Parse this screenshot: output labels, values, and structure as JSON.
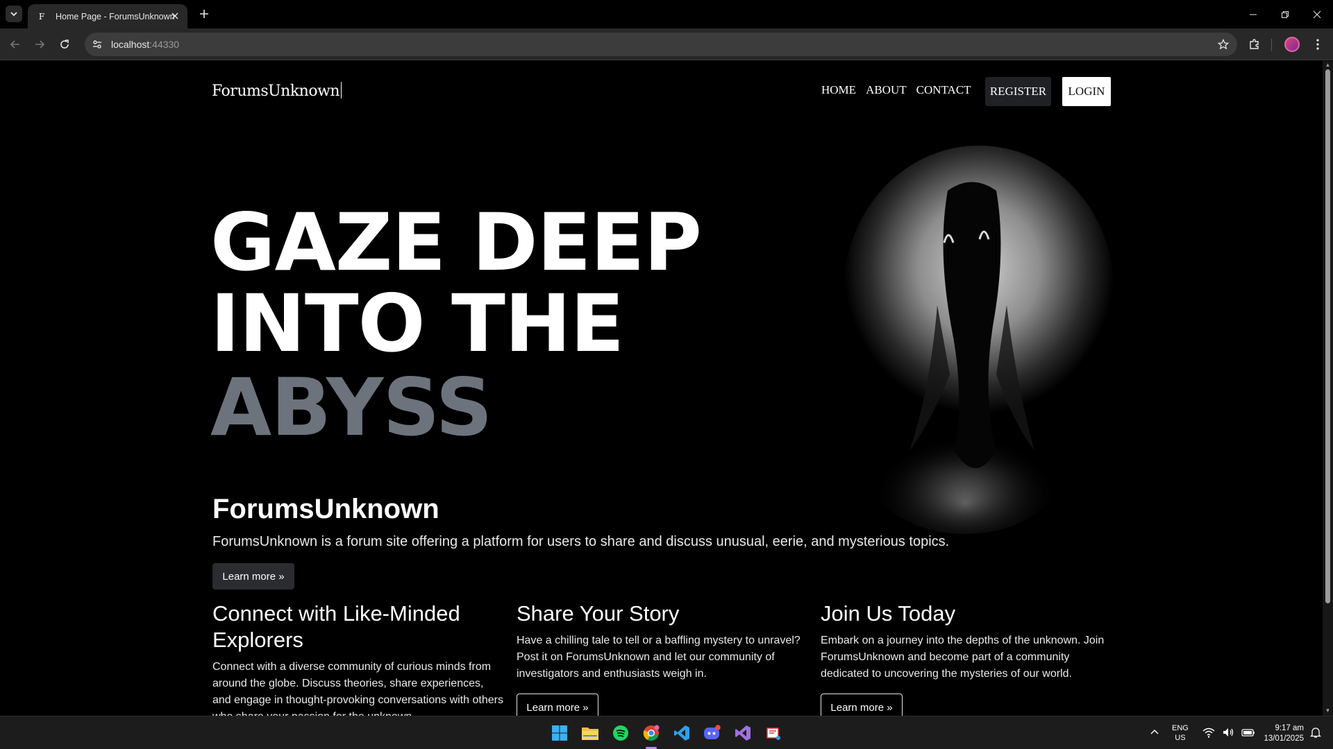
{
  "browser": {
    "tab_title": "Home Page - ForumsUnknown",
    "tab_favicon_letter": "F",
    "url_host": "localhost",
    "url_port": ":44330"
  },
  "site": {
    "brand": "ForumsUnknown",
    "nav": [
      "HOME",
      "ABOUT",
      "CONTACT"
    ],
    "register_label": "REGISTER",
    "login_label": "LOGIN"
  },
  "hero": {
    "line1": "GAZE DEEP",
    "line2": "INTO THE",
    "line3": "ABYSS"
  },
  "intro": {
    "title": "ForumsUnknown",
    "lead": "ForumsUnknown is a forum site offering a platform for users to share and discuss unusual, eerie, and mysterious topics.",
    "button": "Learn more »"
  },
  "columns": [
    {
      "title": "Connect with Like-Minded Explorers",
      "text": "Connect with a diverse community of curious minds from around the globe. Discuss theories, share experiences, and engage in thought-provoking conversations with others who share your passion for the unknown."
    },
    {
      "title": "Share Your Story",
      "text": "Have a chilling tale to tell or a baffling mystery to unravel? Post it on ForumsUnknown and let our community of investigators and enthusiasts weigh in.",
      "button": "Learn more »"
    },
    {
      "title": "Join Us Today",
      "text": "Embark on a journey into the depths of the unknown. Join ForumsUnknown and become part of a community dedicated to uncovering the mysteries of our world.",
      "button": "Learn more »"
    }
  ],
  "taskbar": {
    "lang_line1": "ENG",
    "lang_line2": "US",
    "time": "9:17 am",
    "date": "13/01/2025",
    "apps": [
      "windows-start-icon",
      "file-explorer-icon",
      "spotify-icon",
      "chrome-icon",
      "vscode-icon",
      "discord-icon",
      "visual-studio-icon",
      "snipping-tool-icon"
    ]
  }
}
